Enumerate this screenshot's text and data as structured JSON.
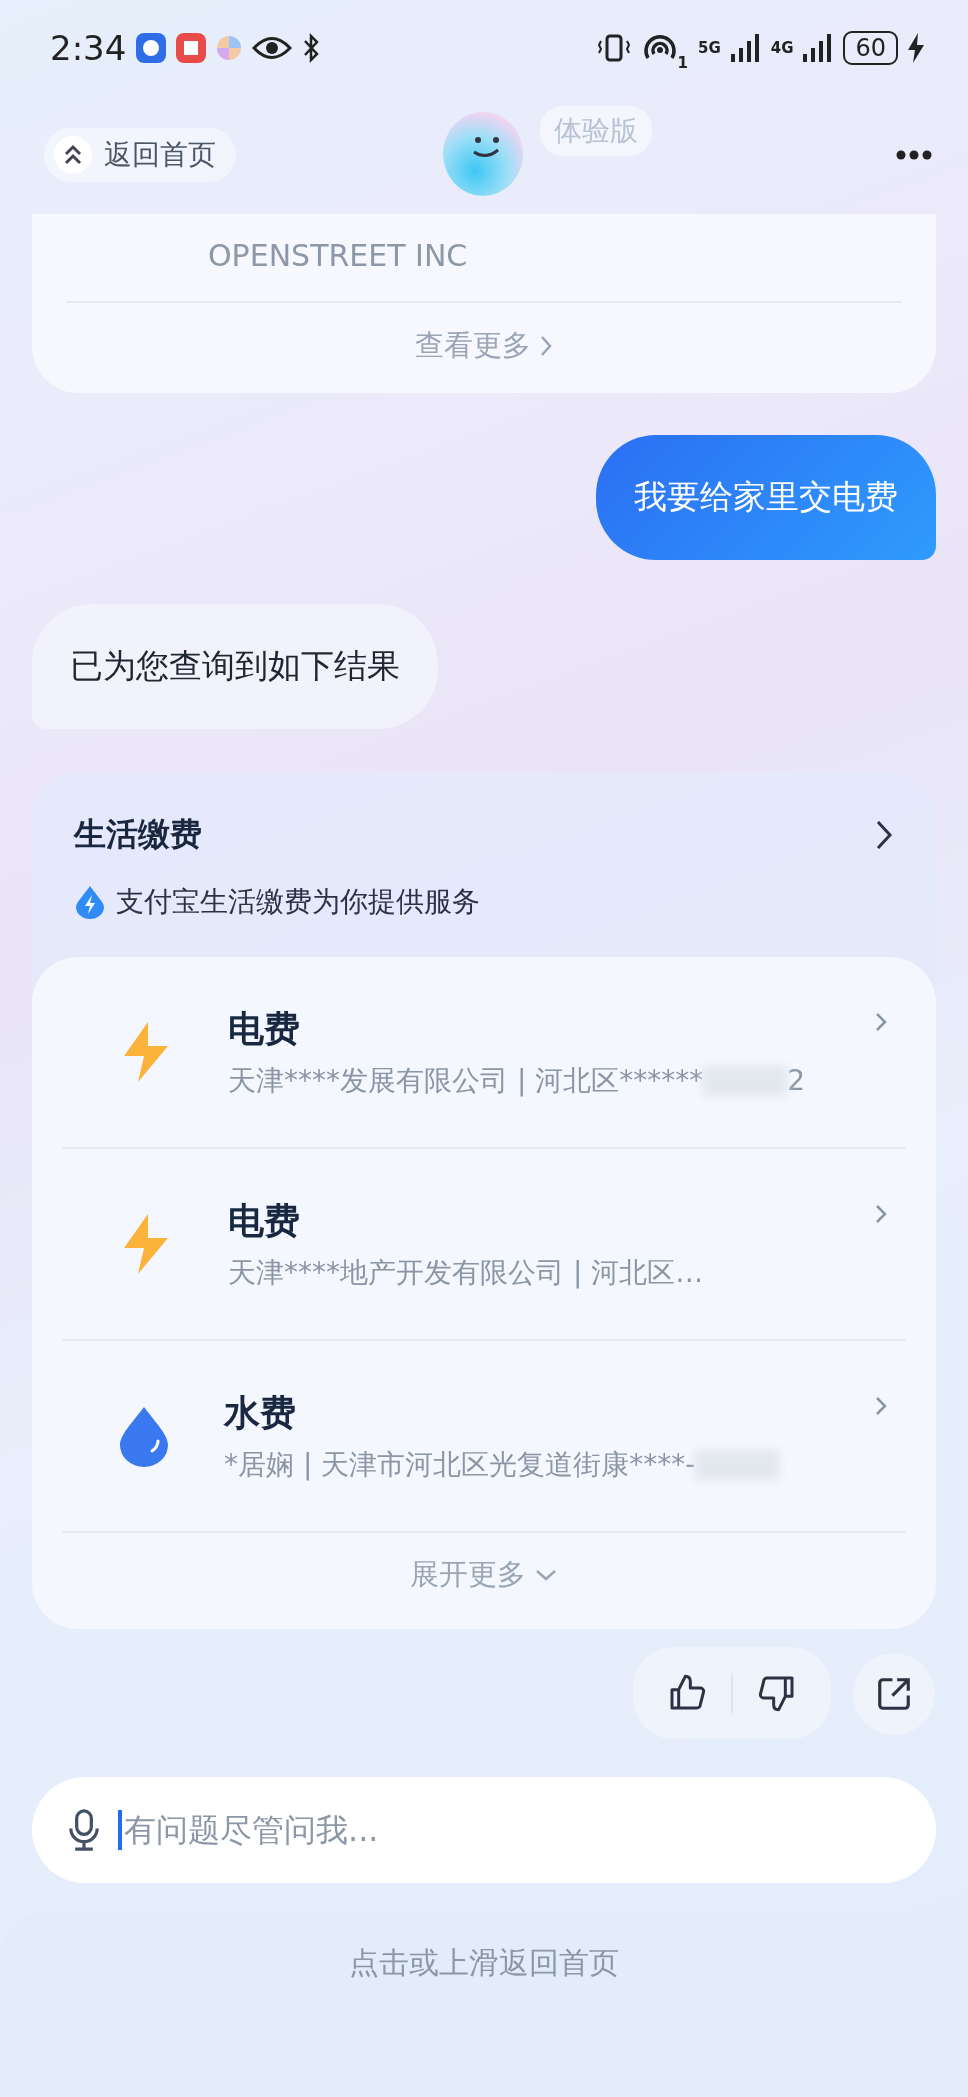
{
  "status_bar": {
    "time": "2:34",
    "hotspot_badge": "1",
    "network_1": "5G",
    "network_2": "4G",
    "battery": "60"
  },
  "header": {
    "back_label": "返回首页",
    "badge": "体验版"
  },
  "previous_card": {
    "company": "OPENSTREET INC",
    "more_label": "查看更多"
  },
  "messages": [
    {
      "kind": "user",
      "text": "我要给家里交电费"
    },
    {
      "kind": "bot",
      "text": "已为您查询到如下结果"
    }
  ],
  "service_card": {
    "title": "生活缴费",
    "provider": "支付宝生活缴费为你提供服务",
    "items": [
      {
        "kind": "electric",
        "title": "电费",
        "subtitle": "天津****发展有限公司 | 河北区******",
        "redacted": true,
        "tail": "2"
      },
      {
        "kind": "electric",
        "title": "电费",
        "subtitle": "天津****地产开发有限公司 | 河北区…",
        "redacted": false
      },
      {
        "kind": "water",
        "title": "水费",
        "subtitle": "*居娴 | 天津市河北区光复道街康****-",
        "redacted": true
      }
    ],
    "expand_label": "展开更多"
  },
  "input": {
    "placeholder": "有问题尽管问我..."
  },
  "footer": {
    "hint": "点击或上滑返回首页"
  }
}
